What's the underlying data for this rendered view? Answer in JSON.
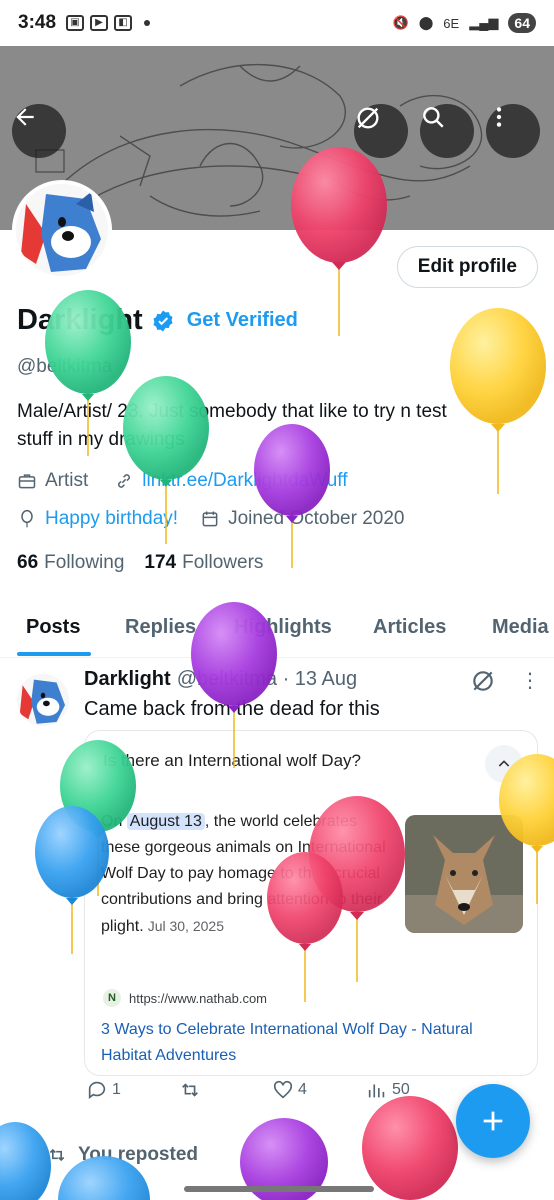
{
  "status_bar": {
    "time": "3:48",
    "battery": "64",
    "signal": "6E"
  },
  "profile": {
    "edit_profile_label": "Edit profile",
    "display_name": "Darklight",
    "get_verified_label": "Get Verified",
    "handle": "@beltkitma",
    "bio_line1": "Male/Artist/ 23. Just somebody that like to try n test",
    "bio_line2": "stuff in my drawings",
    "category": "Artist",
    "link": "linktr.ee/DarklightdaWuff",
    "birthday": "Happy birthday!",
    "joined": "Joined October 2020",
    "following_count": "66",
    "following_label": "Following",
    "followers_count": "174",
    "followers_label": "Followers"
  },
  "tabs": [
    "Posts",
    "Replies",
    "Highlights",
    "Articles",
    "Media"
  ],
  "active_tab": "Posts",
  "post": {
    "author": "Darklight",
    "handle_time": "@beltkitma · 13 Aug",
    "text": "Came back from the dead for this",
    "card": {
      "title": "Is there an International wolf Day?",
      "body_pre": "On ",
      "body_highlight": "August 13",
      "body_post": ", the world celebrates these gorgeous animals on International Wolf Day to pay homage to their crucial contributions and bring attention to their plight.",
      "date": "Jul 30, 2025",
      "source_url": "https://www.nathab.com",
      "source_icon": "N",
      "link_title": "3 Ways to Celebrate International Wolf Day - Natural Habitat Adventures"
    },
    "replies": "1",
    "likes": "4",
    "views": "50"
  },
  "repost_label": "You reposted",
  "icons": {
    "back": "arrow-left-icon",
    "grok": "grok-icon",
    "search": "search-icon",
    "more": "more-vertical-icon",
    "verified": "verified-badge-icon",
    "briefcase": "briefcase-icon",
    "link": "link-icon",
    "balloon": "balloon-icon",
    "calendar": "calendar-icon",
    "reply": "reply-icon",
    "retweet": "retweet-icon",
    "like": "heart-icon",
    "views": "views-icon",
    "compose": "compose-plus-icon"
  },
  "colors": {
    "accent": "#1d9bf0",
    "text_primary": "#0f1419",
    "text_secondary": "#536471",
    "balloon_red": "#f0426a",
    "balloon_green": "#3fd596",
    "balloon_purple": "#a83ee0",
    "balloon_yellow": "#ffd23a",
    "balloon_blue": "#3aa2f0"
  }
}
